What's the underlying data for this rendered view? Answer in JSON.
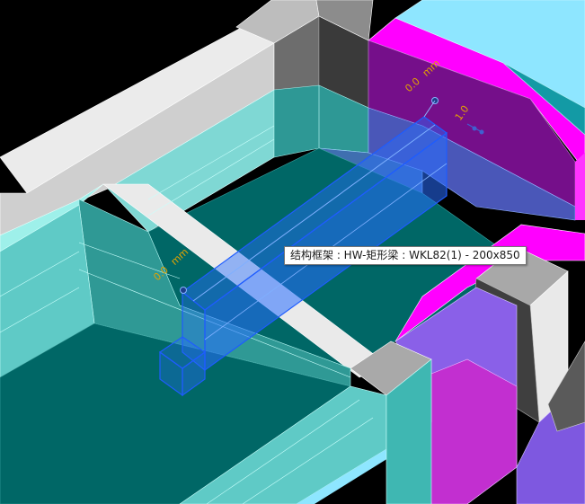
{
  "viewport": {
    "dimension_labels": {
      "top": "0.0",
      "top_unit": "mm",
      "top_right": "1.0",
      "left": "0.0",
      "left_unit": "mm"
    },
    "tooltip": {
      "text": "结构框架 : HW-矩形梁 : WKL82(1) - 200x850"
    },
    "colors": {
      "background": "#000000",
      "slab_teal": "#006666",
      "wall_cyan": "#5fcac6",
      "wall_cyan_dark": "#2f9a96",
      "beam_gray": "#e6e6e6",
      "column_gray": "#a0a0a0",
      "magenta": "#ff00ff",
      "purple": "#7f00a8",
      "violet": "#8a5fe8",
      "selection_blue": "#1e5cff",
      "light_blue": "#80e0ff",
      "dimension_text": "#d9a300"
    }
  }
}
